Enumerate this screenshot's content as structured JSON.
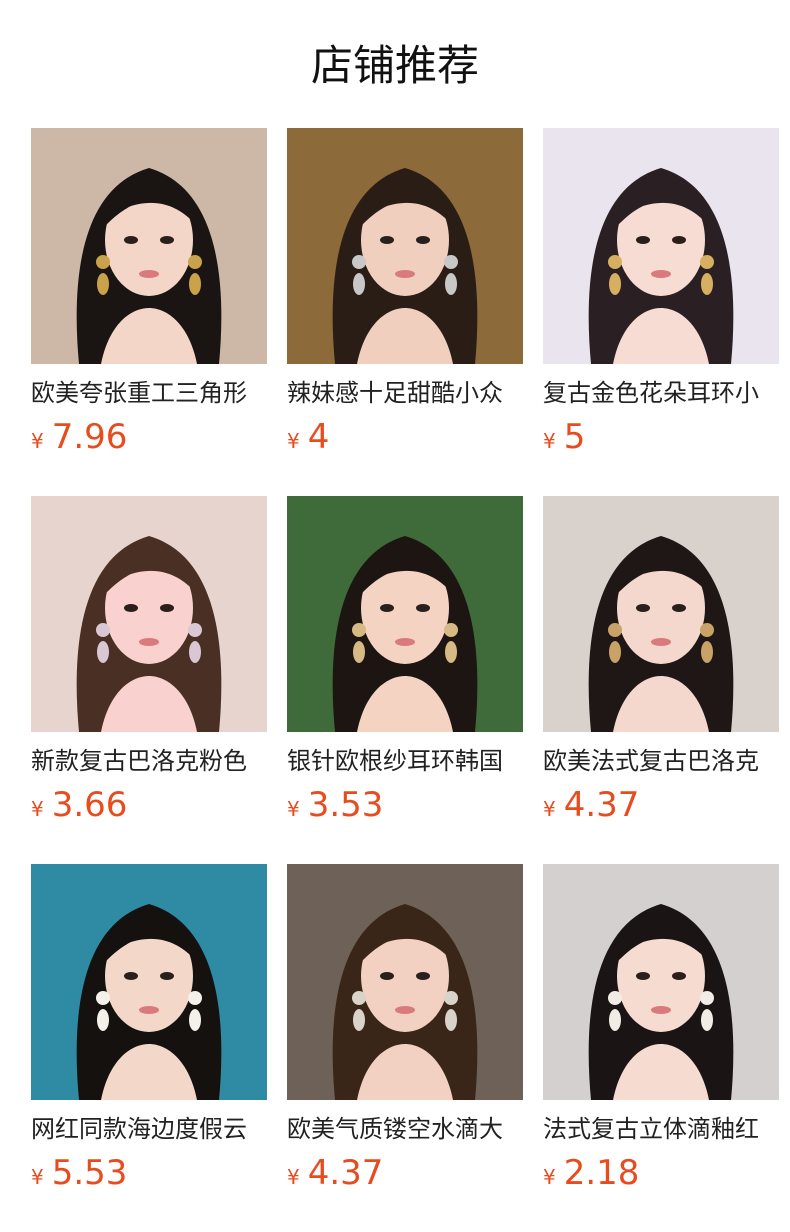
{
  "header": {
    "title": "店铺推荐"
  },
  "colors": {
    "price": "#e84c1e",
    "title": "#111111",
    "name": "#222222"
  },
  "products": [
    {
      "name": "欧美夸张重工三角形",
      "currency": "¥",
      "price": "7.96",
      "image": "woman-with-gold-jeweled-earrings-photo",
      "bg": "#cdb8a7",
      "hair": "#1a1412",
      "skin": "#f3d6c7",
      "accent": "#c9a24a"
    },
    {
      "name": "辣妹感十足甜酷小众",
      "currency": "¥",
      "price": "4",
      "image": "woman-with-silver-cross-earrings-photo",
      "bg": "#8c6a3a",
      "hair": "#2a1d16",
      "skin": "#f0cfbf",
      "accent": "#c8c8c8"
    },
    {
      "name": "复古金色花朵耳环小",
      "currency": "¥",
      "price": "5",
      "image": "woman-with-gold-flower-earrings-photo",
      "bg": "#e9e4ee",
      "hair": "#2a2024",
      "skin": "#f7dcd3",
      "accent": "#d6b060"
    },
    {
      "name": "新款复古巴洛克粉色",
      "currency": "¥",
      "price": "3.66",
      "image": "woman-with-pink-baroque-earrings-photo",
      "bg": "#e8d4cf",
      "hair": "#4a3024",
      "skin": "#f9d2cf",
      "accent": "#d9c8d4"
    },
    {
      "name": "银针欧根纱耳环韩国",
      "currency": "¥",
      "price": "3.53",
      "image": "woman-in-straw-hat-with-flower-earring-photo",
      "bg": "#3f6a3a",
      "hair": "#1d1511",
      "skin": "#f4d3c3",
      "accent": "#d7b985"
    },
    {
      "name": "欧美法式复古巴洛克",
      "currency": "¥",
      "price": "4.37",
      "image": "woman-with-pearl-drop-earrings-photo",
      "bg": "#d9d2cc",
      "hair": "#1e1716",
      "skin": "#f5d8cd",
      "accent": "#c8a267"
    },
    {
      "name": "网红同款海边度假云",
      "currency": "¥",
      "price": "5.53",
      "image": "woman-by-the-sea-with-earrings-photo",
      "bg": "#2f8aa3",
      "hair": "#15110f",
      "skin": "#f3d8c9",
      "accent": "#f4f1ea"
    },
    {
      "name": "欧美气质镂空水滴大",
      "currency": "¥",
      "price": "4.37",
      "image": "woman-with-crystal-drop-earrings-photo",
      "bg": "#6e6258",
      "hair": "#3a2618",
      "skin": "#f2d1c2",
      "accent": "#d9d3c9"
    },
    {
      "name": "法式复古立体滴釉红",
      "currency": "¥",
      "price": "2.18",
      "image": "woman-with-white-flower-earrings-photo",
      "bg": "#d3d0cf",
      "hair": "#1a1514",
      "skin": "#f6dbd0",
      "accent": "#f1ece6"
    }
  ]
}
